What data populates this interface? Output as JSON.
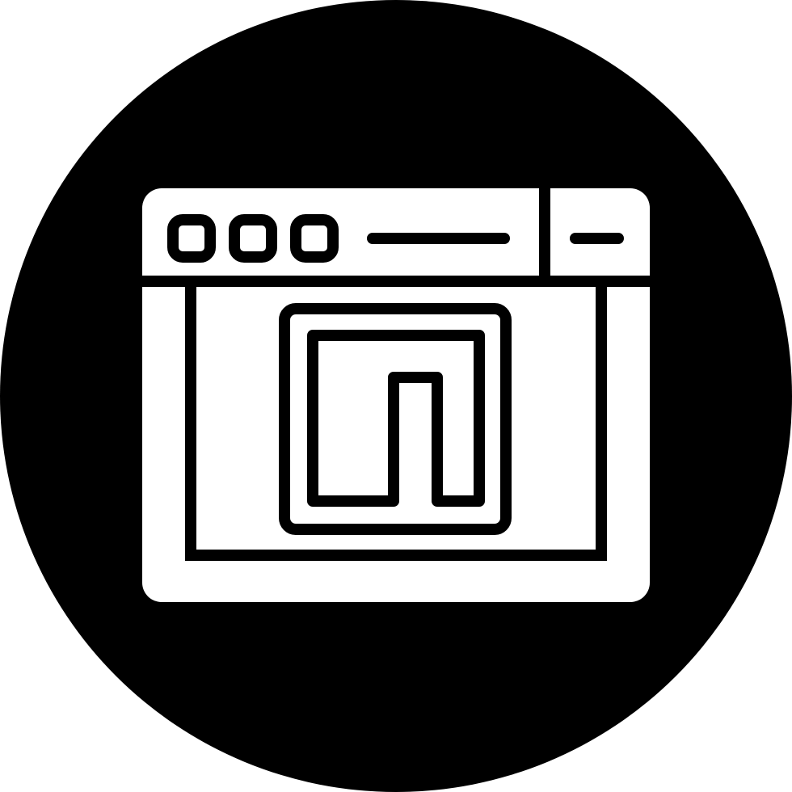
{
  "icon": {
    "name": "browser-window-plugin-icon",
    "background_color": "#000000",
    "foreground_color": "#ffffff",
    "window_controls": [
      "control-1",
      "control-2",
      "control-3"
    ]
  }
}
